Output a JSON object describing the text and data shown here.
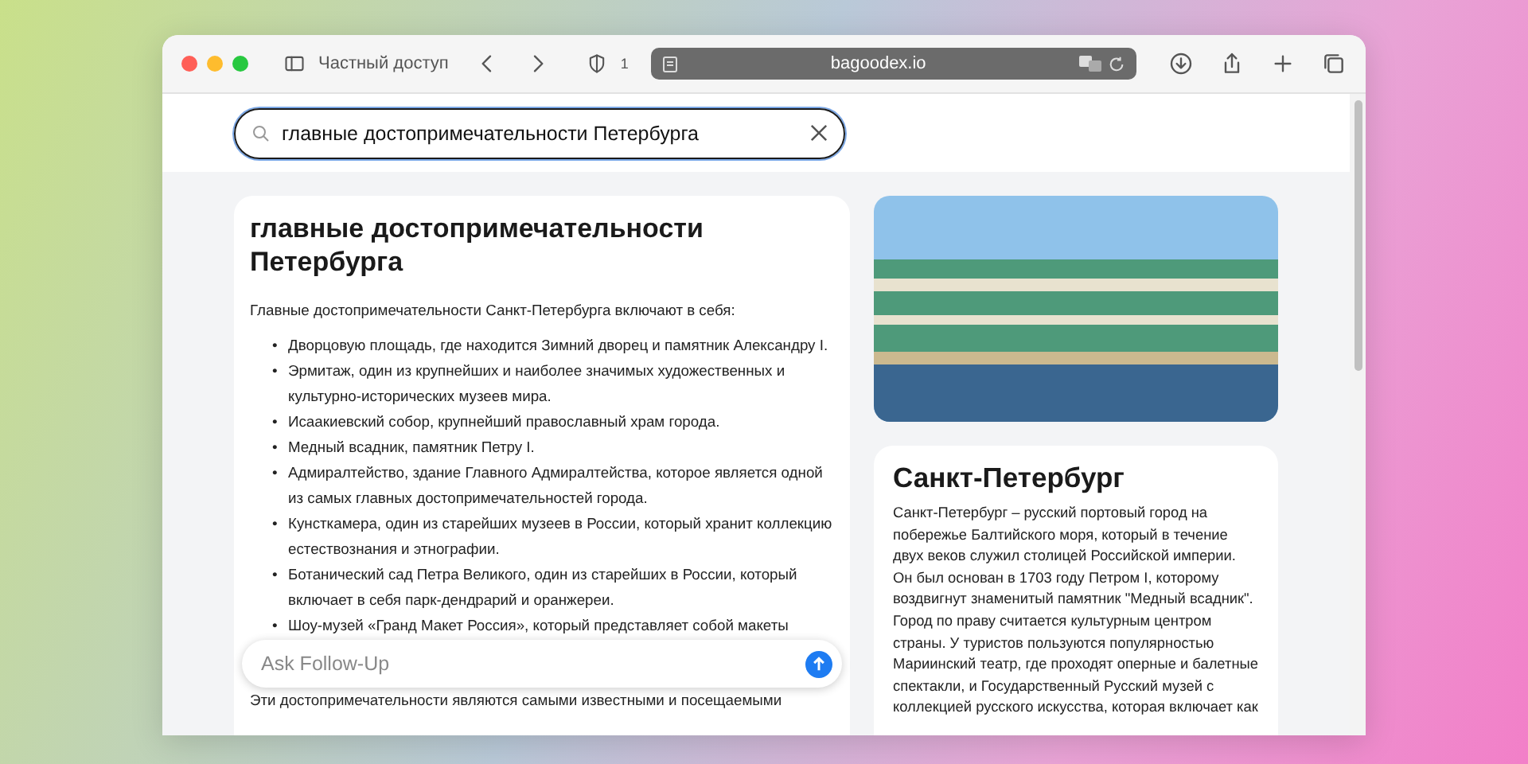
{
  "browser": {
    "private_label": "Частный доступ",
    "tracker_count": "1",
    "url": "bagoodex.io"
  },
  "search": {
    "value": "главные достопримечательности Петербурга"
  },
  "answer": {
    "title": "главные достопримечательности Петербурга",
    "intro": "Главные достопримечательности Санкт-Петербурга включают в себя:",
    "bullet": "•",
    "items": [
      "Дворцовую площадь, где находится Зимний дворец и памятник Александру I.",
      "Эрмитаж, один из крупнейших и наиболее значимых художественных и культурно-исторических музеев мира.",
      "Исаакиевский собор, крупнейший православный храм города.",
      "Медный всадник, памятник Петру I.",
      "Адмиралтейство, здание Главного Адмиралтейства, которое является одной из самых главных достопримечательностей города.",
      "Кунсткамера, один из старейших музеев в России, который хранит коллекцию естествознания и этнографии.",
      "Ботанический сад Петра Великого, один из старейших в России, который включает в себя парк-дендрарий и оранжереи.",
      "Шоу-музей «Гранд Макет Россия», который представляет собой макеты"
    ],
    "outro": "Эти достопримечательности являются самыми известными и посещаемыми"
  },
  "followup": {
    "placeholder": "Ask Follow-Up"
  },
  "info": {
    "title": "Санкт-Петербург",
    "text": "Санкт-Петербург – русский портовый город на побережье Балтийского моря, который в течение двух веков служил столицей Российской империи. Он был основан в 1703 году Петром I, которому воздвигнут знаменитый памятник \"Медный всадник\". Город по праву считается культурным центром страны. У туристов пользуются популярностью Мариинский театр, где проходят оперные и балетные спектакли, и Государственный Русский музей с коллекцией русского искусства, которая включает как"
  }
}
